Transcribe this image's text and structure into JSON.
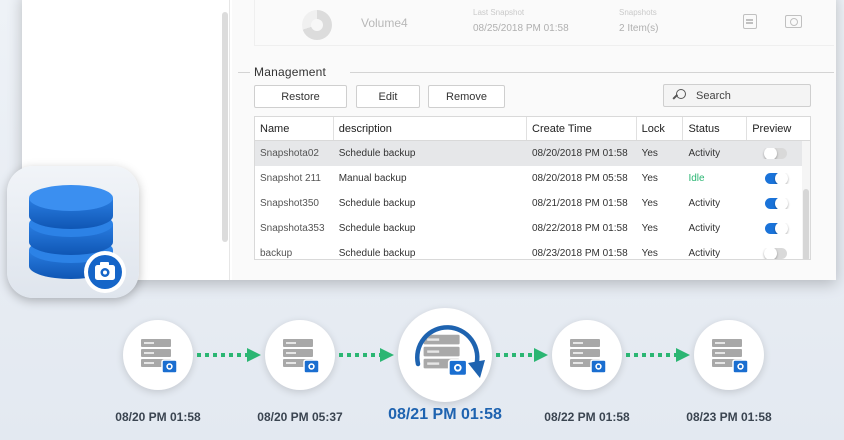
{
  "volume_row": {
    "name": "Volume4",
    "label_a": "Last Snapshot",
    "date": "08/25/2018 PM 01:58",
    "label_b": "Snapshots",
    "items": "2 Item(s)"
  },
  "management": {
    "title": "Management",
    "buttons": {
      "restore": "Restore",
      "edit": "Edit",
      "remove": "Remove"
    },
    "search_placeholder": "Search"
  },
  "table": {
    "headers": [
      "Name",
      "description",
      "Create Time",
      "Lock",
      "Status",
      "Preview"
    ],
    "rows": [
      {
        "name": "Snapshota02",
        "description": "Schedule backup",
        "time": "08/20/2018 PM 01:58",
        "lock": "Yes",
        "status": "Activity",
        "preview": false,
        "selected": true
      },
      {
        "name": "Snapshot 211",
        "description": "Manual backup",
        "time": "08/20/2018 PM 05:58",
        "lock": "Yes",
        "status": "Idle",
        "preview": true,
        "selected": false
      },
      {
        "name": "Snapshot350",
        "description": "Schedule backup",
        "time": "08/21/2018 PM 01:58",
        "lock": "Yes",
        "status": "Activity",
        "preview": true,
        "selected": false
      },
      {
        "name": "Snapshota353",
        "description": "Schedule backup",
        "time": "08/22/2018 PM 01:58",
        "lock": "Yes",
        "status": "Activity",
        "preview": true,
        "selected": false
      },
      {
        "name": "backup",
        "description": "Schedule backup",
        "time": "08/23/2018 PM 01:58",
        "lock": "Yes",
        "status": "Activity",
        "preview": false,
        "selected": false
      }
    ]
  },
  "timeline": {
    "labels": [
      "08/20 PM 01:58",
      "08/20 PM 05:37",
      "08/21 PM 01:58",
      "08/22 PM 01:58",
      "08/23 PM 01:58"
    ],
    "active_index": 2
  },
  "colors": {
    "accent": "#1a73d9",
    "idle": "#2bb673",
    "arrow": "#2bb673",
    "db_blue": "#1565c8"
  },
  "icons": {
    "app": "database-camera-icon",
    "node": "server-camera-icon",
    "search": "search-icon"
  }
}
